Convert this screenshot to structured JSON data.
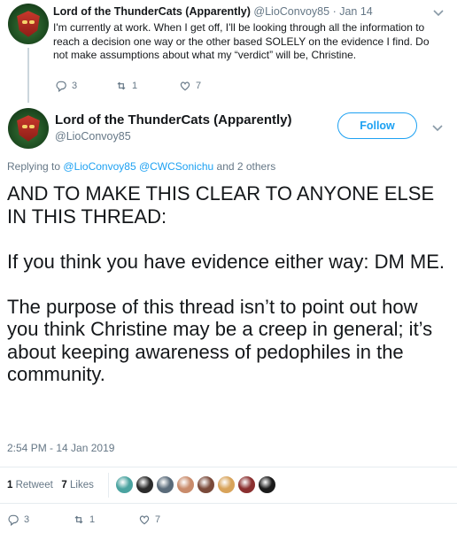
{
  "parent_tweet": {
    "display_name": "Lord of the ThunderCats (Apparently)",
    "handle": "@LioConvoy85",
    "separator": "·",
    "date": "Jan 14",
    "body": "I'm currently at work. When I get off, I'll be looking through all the information to reach a decision one way or the other based SOLELY on the evidence I find. Do not make assumptions about what my “verdict” will be, Christine.",
    "replies": "3",
    "retweets": "1",
    "likes": "7"
  },
  "main_tweet": {
    "display_name": "Lord of the ThunderCats (Apparently)",
    "handle": "@LioConvoy85",
    "follow_label": "Follow",
    "replying_prefix": "Replying to",
    "replying_mentions": "@LioConvoy85 @CWCSonichu",
    "replying_suffix": "and 2 others",
    "body": "AND TO MAKE THIS CLEAR TO ANYONE ELSE IN THIS THREAD:\n\nIf you think you have evidence either way: DM ME.\n\nThe purpose of this thread isn’t to point out how you think Christine may be a creep in general; it’s about keeping awareness of pedophiles in the community.",
    "timestamp": "2:54 PM - 14 Jan 2019",
    "retweet_count": "1",
    "retweet_label": "Retweet",
    "like_count": "7",
    "like_label": "Likes",
    "replies": "3",
    "retweets": "1",
    "likes": "7",
    "liker_avatar_colors": [
      "#4aa3a0",
      "#2b2b2b",
      "#5a6b7a",
      "#c98b6b",
      "#7a4a3a",
      "#d8a35a",
      "#8a2f2f",
      "#1a1a1a"
    ]
  },
  "icons": {
    "reply": "reply-icon",
    "retweet": "retweet-icon",
    "like": "heart-icon",
    "more": "chevron-down-icon"
  },
  "colors": {
    "accent": "#1da1f2",
    "muted": "#657786",
    "text": "#14171a",
    "divider": "#e6ecf0"
  }
}
